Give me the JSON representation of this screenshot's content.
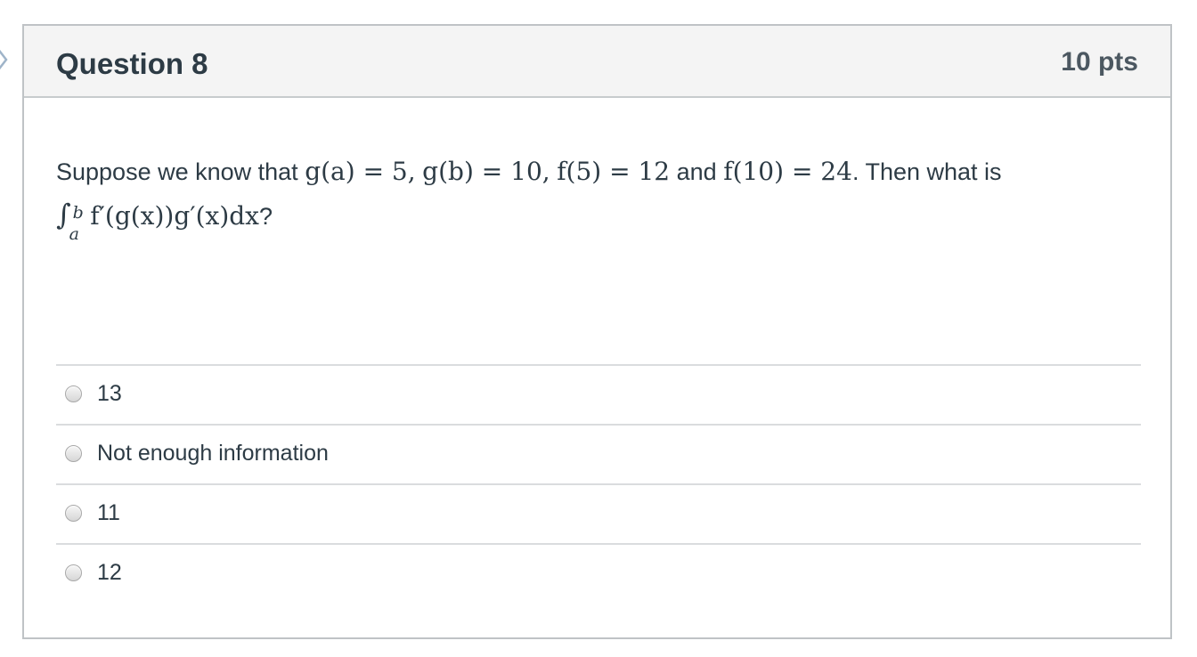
{
  "question": {
    "title": "Question 8",
    "points": "10 pts",
    "text": {
      "part1": "Suppose we know that",
      "eq1": "g(a) = 5,",
      "eq2": "g(b) = 10,",
      "eq3": "f(5) = 12",
      "and": "and",
      "eq4": "f(10) = 24",
      "part2": ". Then what is",
      "integral_lower": "a",
      "integral_upper": "b",
      "integrand": "f′(g(x))g′(x)dx",
      "question_mark": "?"
    }
  },
  "answers": [
    {
      "label": "13",
      "selected": false
    },
    {
      "label": "Not enough information",
      "selected": false
    },
    {
      "label": "11",
      "selected": false
    },
    {
      "label": "12",
      "selected": false
    }
  ],
  "icons": {
    "side_marker": "chevron-right-icon",
    "radio": "radio-button"
  },
  "colors": {
    "header_background": "#f4f4f4",
    "border": "#bfc3c6",
    "text": "#2d3b45",
    "side_marker": "#9fb4c9"
  }
}
